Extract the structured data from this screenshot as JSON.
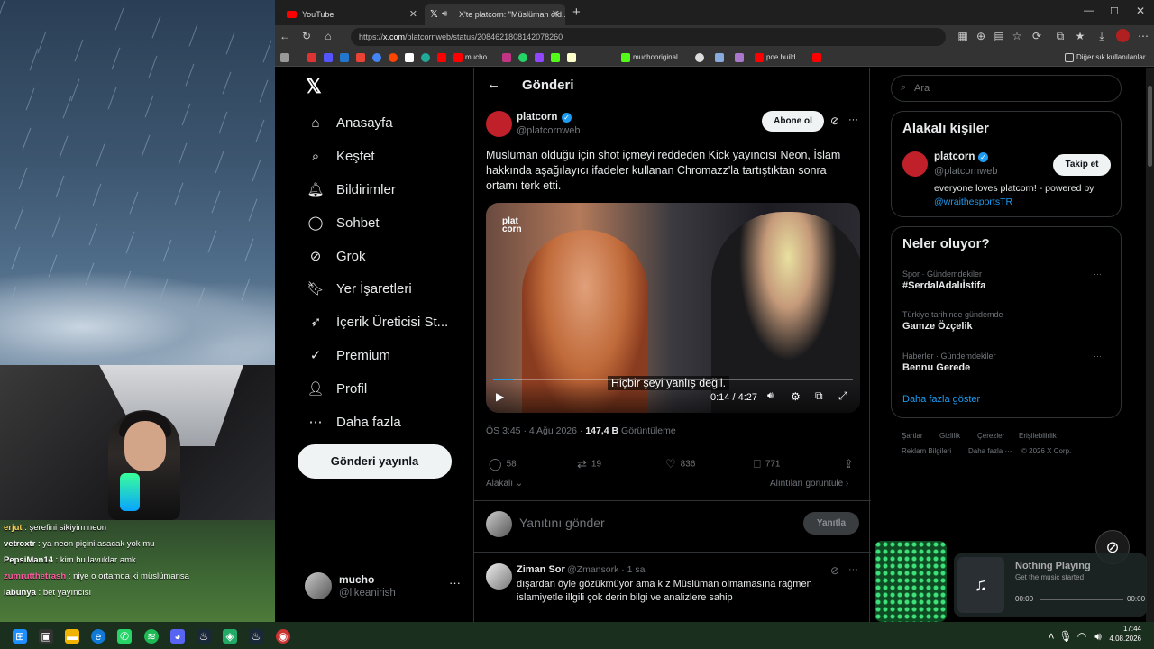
{
  "browser": {
    "tabs": [
      {
        "label": "YouTube"
      },
      {
        "label": "X'te platcorn: \"Müslüman old..."
      }
    ],
    "url_prefix": "https://",
    "url_domain": "x.com",
    "url_path": "/platcornweb/status/2084621808142078260",
    "bookmarks": [
      "mucho",
      "muchooriginal",
      "poe build"
    ],
    "bookmarks_other": "Diğer sık kullanılanlar"
  },
  "nav": {
    "items": [
      {
        "label": "Anasayfa",
        "icon": "home-icon"
      },
      {
        "label": "Keşfet",
        "icon": "search-icon"
      },
      {
        "label": "Bildirimler",
        "icon": "bell-icon"
      },
      {
        "label": "Sohbet",
        "icon": "chat-icon"
      },
      {
        "label": "Grok",
        "icon": "grok-icon"
      },
      {
        "label": "Yer İşaretleri",
        "icon": "bookmark-icon"
      },
      {
        "label": "İçerik Üreticisi St...",
        "icon": "rocket-icon"
      },
      {
        "label": "Premium",
        "icon": "verified-icon"
      },
      {
        "label": "Profil",
        "icon": "user-icon"
      },
      {
        "label": "Daha fazla",
        "icon": "more-icon"
      }
    ],
    "post_button": "Gönderi yayınla",
    "account_name": "mucho",
    "account_handle": "@likeanirish"
  },
  "main": {
    "header": "Gönderi",
    "author_name": "platcorn",
    "author_handle": "@platcornweb",
    "subscribe_label": "Abone ol",
    "text": "Müslüman olduğu için shot içmeyi reddeden Kick yayıncısı Neon, İslam hakkında aşağılayıcı ifadeler kullanan Chromazz'la tartıştıktan sonra ortamı terk etti.",
    "video_subtitle": "Hiçbir şeyi yanlış değil.",
    "video_time": "0:14 / 4:27",
    "meta_time": "ÖS 3:45 · 4 Ağu 2026 · ",
    "views_count": "147,4 B",
    "views_label": " Görüntüleme",
    "replies": "58",
    "reposts": "19",
    "likes": "836",
    "bookmarks": "771",
    "relevance": "Alakalı",
    "view_quotes": "Alıntıları görüntüle ›",
    "reply_placeholder": "Yanıtını gönder",
    "reply_button": "Yanıtla",
    "reply": {
      "name": "Ziman Sor",
      "handle": "@Zmansork · 1 sa",
      "text": "dışardan öyle gözükmüyor ama kız Müslüman olmamasına rağmen islamiyetle illgili çok derin bilgi ve analizlere sahip"
    }
  },
  "right": {
    "search_placeholder": "Ara",
    "related_title": "Alakalı kişiler",
    "related_name": "platcorn",
    "related_handle": "@platcornweb",
    "follow_label": "Takip et",
    "related_bio": "everyone loves platcorn! - powered by",
    "related_link": "@wraithesportsTR",
    "trends_title": "Neler oluyor?",
    "trends": [
      {
        "meta": "Spor · Gündemdekiler",
        "name": "#SerdalAdalıİstifa"
      },
      {
        "meta": "Türkiye tarihinde gündemde",
        "name": "Gamze Özçelik"
      },
      {
        "meta": "Haberler · Gündemdekiler",
        "name": "Bennu Gerede"
      }
    ],
    "show_more": "Daha fazla göster",
    "footer": [
      "Şartlar",
      "Gizlilik",
      "Çerezler",
      "Erişilebilirlik",
      "Reklam Bilgileri",
      "Daha fazla ···",
      "© 2026 X Corp."
    ]
  },
  "chat": [
    {
      "user": "erjut",
      "msg": " : şerefini sikiyim neon",
      "color": "#ffd25a"
    },
    {
      "user": "vetroxtr",
      "msg": " : ya neon piçini asacak yok mu",
      "color": "#ffffff"
    },
    {
      "user": "PepsiMan14",
      "msg": " : kim bu lavuklar amk",
      "color": "#ffffff"
    },
    {
      "user": "zumrutthetrash",
      "msg": " : niye o ortamda ki müslümansa",
      "color": "#ff5aa0"
    },
    {
      "user": "labunya",
      "msg": " : bet yayıncısı",
      "color": "#ffffff"
    }
  ],
  "music": {
    "title": "Nothing Playing",
    "subtitle": "Get the music started",
    "time_start": "00:00",
    "time_end": "00:00"
  },
  "clock": {
    "time": "17:44",
    "date": "4.08.2026"
  }
}
